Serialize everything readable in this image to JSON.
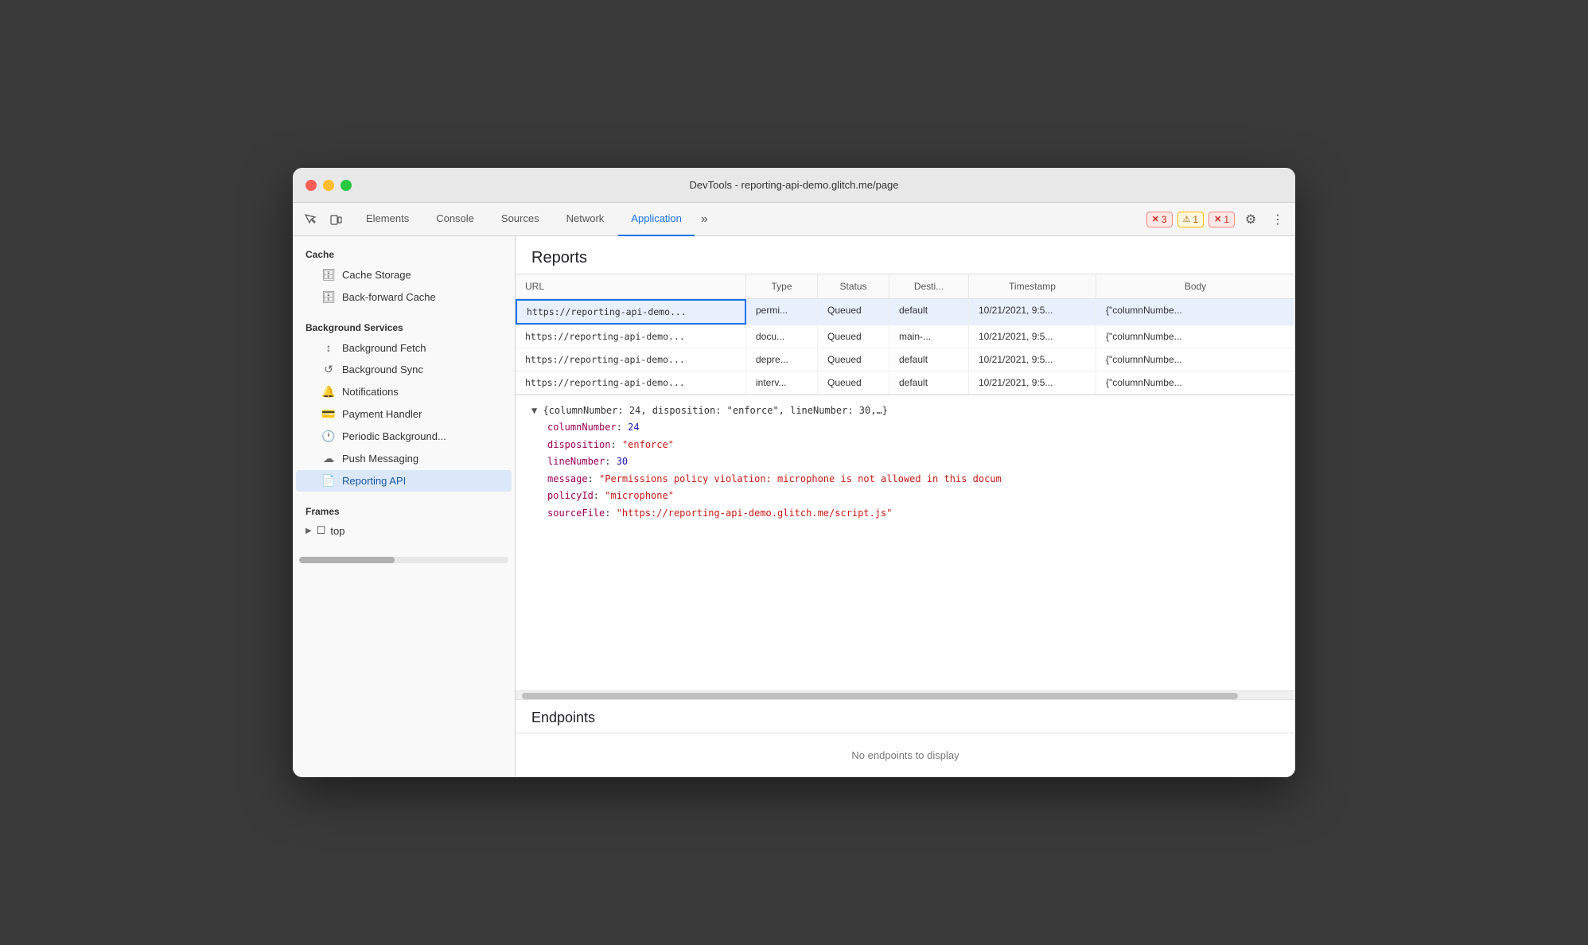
{
  "window": {
    "title": "DevTools - reporting-api-demo.glitch.me/page"
  },
  "toolbar": {
    "tabs": [
      {
        "id": "elements",
        "label": "Elements",
        "active": false
      },
      {
        "id": "console",
        "label": "Console",
        "active": false
      },
      {
        "id": "sources",
        "label": "Sources",
        "active": false
      },
      {
        "id": "network",
        "label": "Network",
        "active": false
      },
      {
        "id": "application",
        "label": "Application",
        "active": true
      }
    ],
    "more_tabs_label": "»",
    "error_badge": {
      "icon": "✕",
      "count": "3"
    },
    "warning_badge": {
      "icon": "⚠",
      "count": "1"
    },
    "error_badge2": {
      "icon": "✕",
      "count": "1"
    },
    "gear_icon": "⚙",
    "dots_icon": "⋮"
  },
  "sidebar": {
    "cache_label": "Cache",
    "cache_storage_label": "Cache Storage",
    "back_forward_cache_label": "Back-forward Cache",
    "background_services_label": "Background Services",
    "background_fetch_label": "Background Fetch",
    "background_sync_label": "Background Sync",
    "notifications_label": "Notifications",
    "payment_handler_label": "Payment Handler",
    "periodic_background_label": "Periodic Background...",
    "push_messaging_label": "Push Messaging",
    "reporting_api_label": "Reporting API",
    "frames_label": "Frames",
    "top_label": "top"
  },
  "reports": {
    "title": "Reports",
    "table_headers": [
      "URL",
      "Type",
      "Status",
      "Desti...",
      "Timestamp",
      "Body"
    ],
    "rows": [
      {
        "url": "https://reporting-api-demo...",
        "type": "permi...",
        "status": "Queued",
        "destination": "default",
        "timestamp": "10/21/2021, 9:5...",
        "body": "{\"columnNumbe...",
        "selected": true
      },
      {
        "url": "https://reporting-api-demo...",
        "type": "docu...",
        "status": "Queued",
        "destination": "main-...",
        "timestamp": "10/21/2021, 9:5...",
        "body": "{\"columnNumbe...",
        "selected": false
      },
      {
        "url": "https://reporting-api-demo...",
        "type": "depre...",
        "status": "Queued",
        "destination": "default",
        "timestamp": "10/21/2021, 9:5...",
        "body": "{\"columnNumbe...",
        "selected": false
      },
      {
        "url": "https://reporting-api-demo...",
        "type": "interv...",
        "status": "Queued",
        "destination": "default",
        "timestamp": "10/21/2021, 9:5...",
        "body": "{\"columnNumbe...",
        "selected": false
      }
    ],
    "detail": {
      "header": "{columnNumber: 24, disposition: \"enforce\", lineNumber: 30,…}",
      "lines": [
        {
          "key": "columnNumber",
          "colon": ": ",
          "value": "24",
          "type": "num"
        },
        {
          "key": "disposition",
          "colon": ": ",
          "value": "\"enforce\"",
          "type": "str"
        },
        {
          "key": "lineNumber",
          "colon": ": ",
          "value": "30",
          "type": "num"
        },
        {
          "key": "message",
          "colon": ": ",
          "value": "\"Permissions policy violation: microphone is not allowed in this docum",
          "type": "str"
        },
        {
          "key": "policyId",
          "colon": ": ",
          "value": "\"microphone\"",
          "type": "str"
        },
        {
          "key": "sourceFile",
          "colon": ": ",
          "value": "\"https://reporting-api-demo.glitch.me/script.js\"",
          "type": "str"
        }
      ]
    }
  },
  "endpoints": {
    "title": "Endpoints",
    "empty_message": "No endpoints to display"
  }
}
